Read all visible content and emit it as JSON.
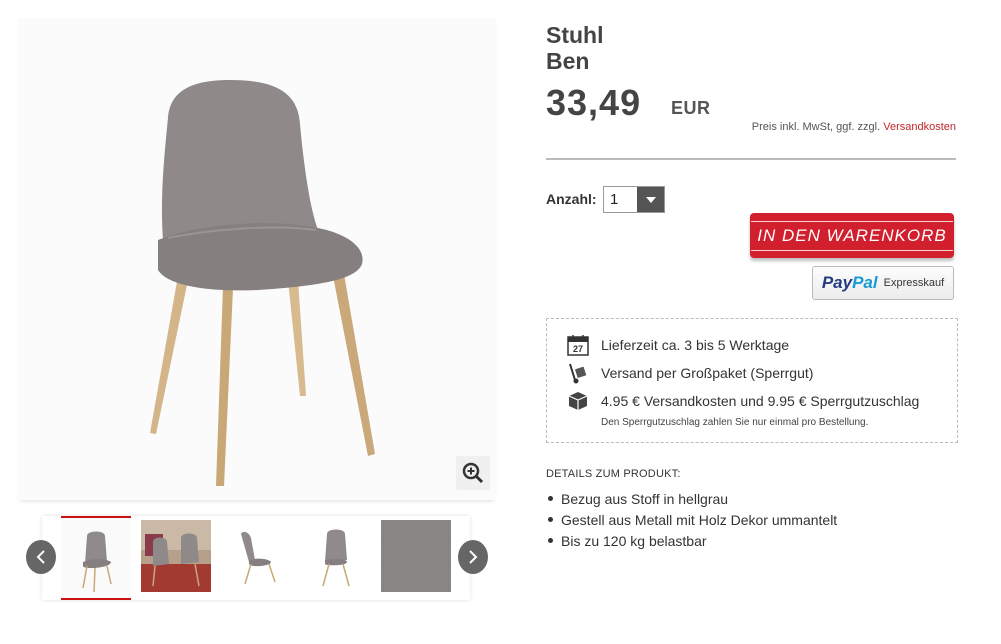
{
  "product": {
    "title_line1": "Stuhl",
    "title_line2": "Ben",
    "price": "33,49",
    "currency": "EUR",
    "tax_note": "Preis inkl. MwSt, ggf. zzgl.",
    "shipping_link": "Versandkosten"
  },
  "gallery": {
    "thumbnails": [
      "thumb-front-grey",
      "thumb-room-scene",
      "thumb-side-view",
      "thumb-back-view",
      "thumb-fabric-detail"
    ],
    "active_index": 0
  },
  "purchase": {
    "qty_label": "Anzahl:",
    "qty_value": "1",
    "cart_button": "IN DEN WARENKORB",
    "paypal_pay": "Pay",
    "paypal_pal": "Pal",
    "paypal_express": "Expresskauf"
  },
  "shipping": {
    "delivery_time": "Lieferzeit ca. 3 bis 5 Werktage",
    "delivery_icon_day": "27",
    "method": "Versand per Großpaket (Sperrgut)",
    "costs": "4.95 € Versandkosten und 9.95 € Sperrgutzuschlag",
    "note": "Den Sperrgutzuschlag zahlen Sie nur einmal pro Bestellung."
  },
  "details": {
    "title": "DETAILS ZUM PRODUKT:",
    "items": [
      "Bezug aus Stoff in hellgrau",
      "Gestell aus Metall mit Holz Dekor ummantelt",
      "Bis zu 120 kg belastbar"
    ]
  },
  "colors": {
    "accent_red": "#d21f2d",
    "link_red": "#c1272d",
    "paypal_dark": "#253b80",
    "paypal_light": "#179bd7"
  }
}
